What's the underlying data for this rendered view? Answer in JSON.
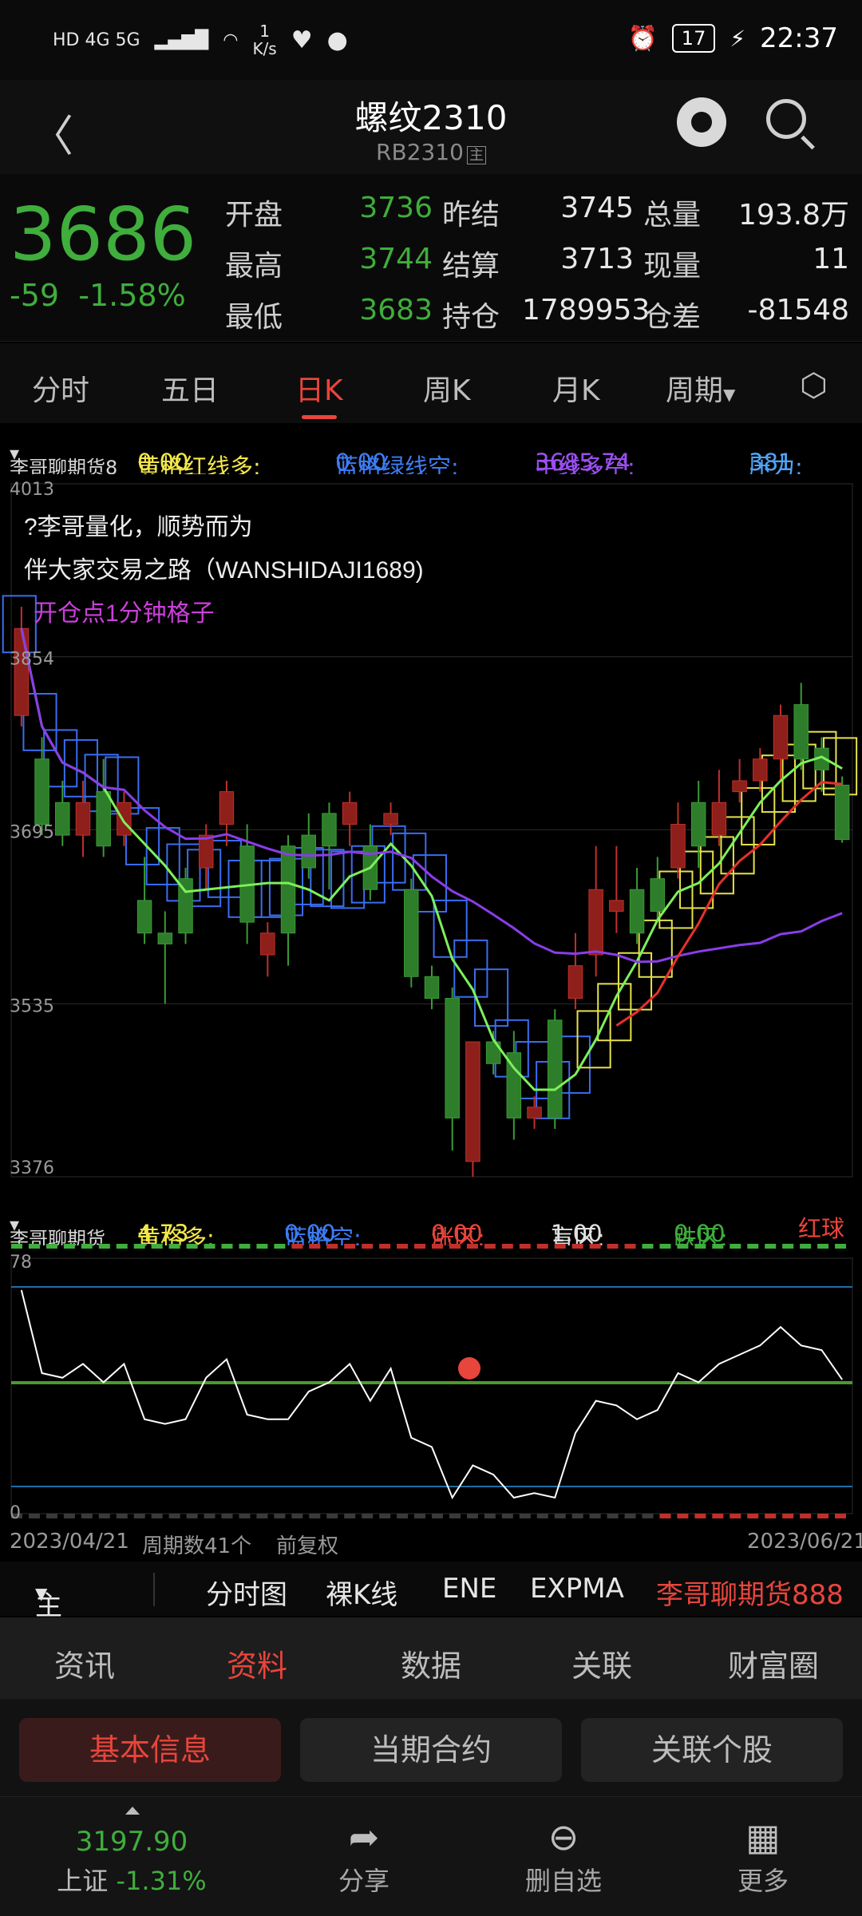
{
  "status_bar": {
    "network": "HD 4G 5G",
    "speed_value": "1",
    "speed_unit": "K/s",
    "battery": "17",
    "time": "22:37",
    "icons": [
      "signal-icon",
      "wifi-icon",
      "heart-icon",
      "qq-icon",
      "alarm-icon",
      "charging-icon"
    ]
  },
  "header": {
    "title": "螺纹2310",
    "subtitle": "RB2310",
    "subtitle_badge": "主",
    "icons": [
      "back-icon",
      "robot-icon",
      "search-icon"
    ]
  },
  "quote": {
    "price": "3686",
    "change": "-59",
    "change_pct": "-1.58%",
    "rows": [
      {
        "l1": "开盘",
        "v1": "3736",
        "l2": "昨结",
        "v2": "3745",
        "l3": "总量",
        "v3": "193.8万"
      },
      {
        "l1": "最高",
        "v1": "3744",
        "l2": "结算",
        "v2": "3713",
        "l3": "现量",
        "v3": "11"
      },
      {
        "l1": "最低",
        "v1": "3683",
        "l2": "持仓",
        "v2": "1789953",
        "l3": "仓差",
        "v3": "-81548"
      }
    ]
  },
  "tabs": [
    "分时",
    "五日",
    "日K",
    "周K",
    "月K",
    "周期"
  ],
  "active_tab": "日K",
  "main_indicator": {
    "name": "李哥聊期货8",
    "yellow_label": "黄格红线多:",
    "yellow_value": "0.00",
    "blue_label": "蓝格绿线空:",
    "blue_value": "0.00",
    "mid_label": "中线多空:",
    "mid_value": "3685.74",
    "pressure_label": "压力:",
    "pressure_value": "381"
  },
  "chart_data": {
    "type": "candlestick",
    "y_ticks": [
      "4013",
      "3854",
      "3695",
      "3535",
      "3376"
    ],
    "ylim": [
      3376,
      4013
    ],
    "annotations": [
      "?李哥量化，顺势而为",
      "伴大家交易之路（WANSHIDAJI1689)",
      "开仓点1分钟格子"
    ],
    "candles": [
      {
        "o": 3800,
        "c": 3880,
        "h": 3900,
        "l": 3790
      },
      {
        "o": 3760,
        "c": 3700,
        "h": 3780,
        "l": 3690
      },
      {
        "o": 3720,
        "c": 3690,
        "h": 3740,
        "l": 3680
      },
      {
        "o": 3690,
        "c": 3720,
        "h": 3740,
        "l": 3670
      },
      {
        "o": 3730,
        "c": 3680,
        "h": 3760,
        "l": 3670
      },
      {
        "o": 3690,
        "c": 3720,
        "h": 3730,
        "l": 3680
      },
      {
        "o": 3630,
        "c": 3600,
        "h": 3670,
        "l": 3590
      },
      {
        "o": 3600,
        "c": 3590,
        "h": 3620,
        "l": 3535
      },
      {
        "o": 3650,
        "c": 3600,
        "h": 3660,
        "l": 3590
      },
      {
        "o": 3660,
        "c": 3690,
        "h": 3700,
        "l": 3640
      },
      {
        "o": 3700,
        "c": 3730,
        "h": 3740,
        "l": 3680
      },
      {
        "o": 3680,
        "c": 3610,
        "h": 3700,
        "l": 3590
      },
      {
        "o": 3580,
        "c": 3600,
        "h": 3610,
        "l": 3560
      },
      {
        "o": 3680,
        "c": 3600,
        "h": 3690,
        "l": 3570
      },
      {
        "o": 3690,
        "c": 3660,
        "h": 3710,
        "l": 3650
      },
      {
        "o": 3710,
        "c": 3680,
        "h": 3720,
        "l": 3640
      },
      {
        "o": 3700,
        "c": 3720,
        "h": 3730,
        "l": 3680
      },
      {
        "o": 3680,
        "c": 3640,
        "h": 3700,
        "l": 3630
      },
      {
        "o": 3700,
        "c": 3710,
        "h": 3720,
        "l": 3690
      },
      {
        "o": 3640,
        "c": 3560,
        "h": 3650,
        "l": 3550
      },
      {
        "o": 3560,
        "c": 3540,
        "h": 3570,
        "l": 3530
      },
      {
        "o": 3540,
        "c": 3430,
        "h": 3550,
        "l": 3400
      },
      {
        "o": 3390,
        "c": 3500,
        "h": 3500,
        "l": 3376
      },
      {
        "o": 3500,
        "c": 3480,
        "h": 3510,
        "l": 3470
      },
      {
        "o": 3490,
        "c": 3430,
        "h": 3510,
        "l": 3410
      },
      {
        "o": 3430,
        "c": 3440,
        "h": 3450,
        "l": 3420
      },
      {
        "o": 3520,
        "c": 3430,
        "h": 3530,
        "l": 3420
      },
      {
        "o": 3540,
        "c": 3570,
        "h": 3600,
        "l": 3530
      },
      {
        "o": 3580,
        "c": 3640,
        "h": 3680,
        "l": 3560
      },
      {
        "o": 3620,
        "c": 3630,
        "h": 3680,
        "l": 3600
      },
      {
        "o": 3640,
        "c": 3600,
        "h": 3660,
        "l": 3590
      },
      {
        "o": 3650,
        "c": 3620,
        "h": 3670,
        "l": 3610
      },
      {
        "o": 3660,
        "c": 3700,
        "h": 3720,
        "l": 3650
      },
      {
        "o": 3720,
        "c": 3680,
        "h": 3740,
        "l": 3660
      },
      {
        "o": 3690,
        "c": 3720,
        "h": 3750,
        "l": 3680
      },
      {
        "o": 3730,
        "c": 3740,
        "h": 3760,
        "l": 3720
      },
      {
        "o": 3740,
        "c": 3760,
        "h": 3770,
        "l": 3730
      },
      {
        "o": 3760,
        "c": 3800,
        "h": 3810,
        "l": 3740
      },
      {
        "o": 3810,
        "c": 3760,
        "h": 3830,
        "l": 3750
      },
      {
        "o": 3770,
        "c": 3750,
        "h": 3780,
        "l": 3730
      },
      {
        "o": 3736,
        "c": 3686,
        "h": 3744,
        "l": 3683
      }
    ]
  },
  "sub_indicator": {
    "name": "李哥聊期货",
    "yellow_label": "黄格多:",
    "yellow_value": "4.73",
    "blue_label": "蓝格空:",
    "blue_value": "0.00",
    "up_label": "涨区:",
    "up_value": "0.00",
    "blind_label": "盲区:",
    "blind_value": "1.00",
    "down_label": "跌区:",
    "down_value": "0.00",
    "red_ball": "红球",
    "scale_top": "78",
    "scale_bottom": "0"
  },
  "axis": {
    "start_date": "2023/04/21",
    "period_count": "周期数41个",
    "adjust": "前复权",
    "end_date": "2023/06/21"
  },
  "toolbar": [
    "主图",
    "分时图",
    "裸K线",
    "ENE",
    "EXPMA",
    "李哥聊期货888"
  ],
  "info_tabs": [
    "资讯",
    "资料",
    "数据",
    "关联",
    "财富圈"
  ],
  "active_info_tab": "资料",
  "sub_buttons": [
    "基本信息",
    "当期合约",
    "关联个股"
  ],
  "active_sub_button": "基本信息",
  "bottom_nav": {
    "index_value": "3197.90",
    "index_name": "上证",
    "index_change": "-1.31%",
    "share": "分享",
    "remove": "删自选",
    "more": "更多"
  }
}
